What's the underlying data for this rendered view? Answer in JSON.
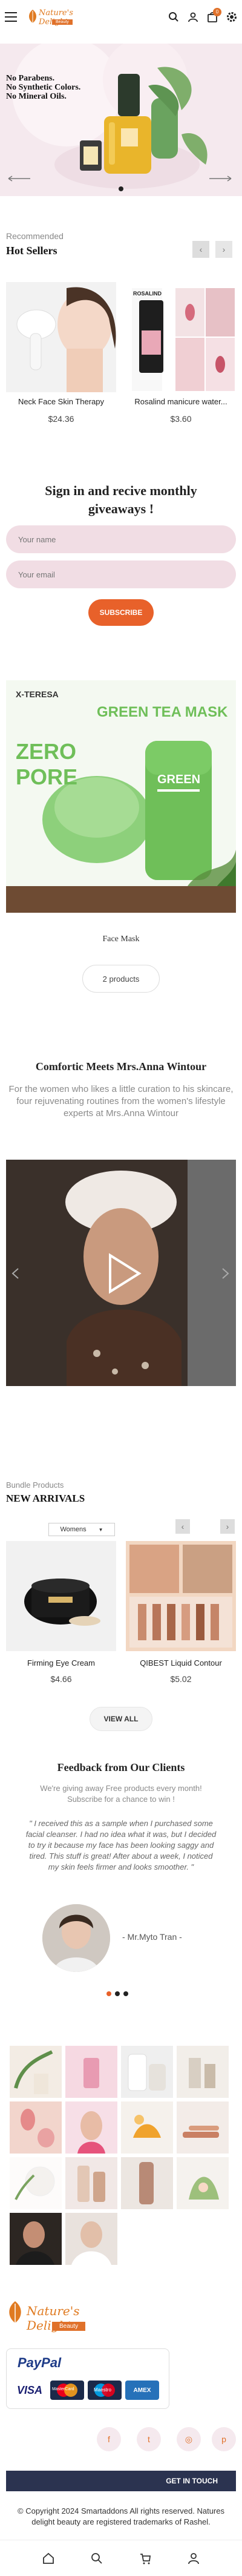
{
  "header": {
    "logo_script": "Nature's Delight",
    "logo_tag": "Beauty",
    "cart_count": "0"
  },
  "hero": {
    "lines": [
      "No Parabens.",
      "No Synthetic Colors.",
      "No Mineral Oils."
    ]
  },
  "hot_sellers": {
    "label": "Recommended",
    "title": "Hot Sellers",
    "products": [
      {
        "name": "Neck Face Skin Therapy",
        "price": "$24.36"
      },
      {
        "name": "Rosalind manicure water...",
        "price": "$3.60"
      }
    ],
    "bottle_brand": "ROSALIND"
  },
  "newsletter": {
    "title_line1": "Sign in and recive monthly",
    "title_line2": "giveaways !",
    "name_placeholder": "Your name",
    "email_placeholder": "Your email",
    "button": "SUBSCRIBE"
  },
  "promo": {
    "brand": "X-TERESA",
    "headline": "GREEN TEA MASK",
    "zero": "ZERO",
    "pore": "PORE",
    "stick_brand": "GREEN",
    "caption": "Face Mask",
    "count": "2 products"
  },
  "about": {
    "title": "Comfortic Meets Mrs.Anna Wintour",
    "text": "For the women who likes a little curation to his skincare, four rejuvenating routines from the women's lifestyle experts at Mrs.Anna Wintour"
  },
  "arrivals": {
    "label": "Bundle Products",
    "title": "NEW ARRIVALS",
    "filter": "Womens",
    "products": [
      {
        "name": "Firming Eye Cream",
        "price": "$4.66"
      },
      {
        "name": "QIBEST Liquid Contour",
        "price": "$5.02"
      }
    ],
    "view_all": "VIEW ALL"
  },
  "testimonials": {
    "title": "Feedback from Our Clients",
    "sub": "We're giving away Free products every month! Subscribe for a chance to win !",
    "quote": "\" I received this as a sample when I purchased some facial cleanser. I had no idea what it was, but I decided to try it because my face has been looking saggy and tired. This stuff is great! After about a week, I noticed my skin feels firmer and looks smoother. \"",
    "author": "- Mr.Myto Tran -"
  },
  "footer": {
    "logo_script": "Nature's Delight",
    "logo_tag": "Beauty",
    "paypal": "PayPal",
    "cards": [
      "VISA",
      "MasterCard",
      "Maestro",
      "AMEX"
    ],
    "contact": "GET IN TOUCH",
    "copyright": "© Copyright 2024 Smartaddons All rights reserved. Natures delight beauty are registered trademarks of Rashel."
  },
  "colors": {
    "accent": "#e8612a",
    "pink_bg": "#f5e9ee",
    "input_bg": "#f1dde4",
    "green": "#6fbf59",
    "navy": "#2b3350"
  }
}
